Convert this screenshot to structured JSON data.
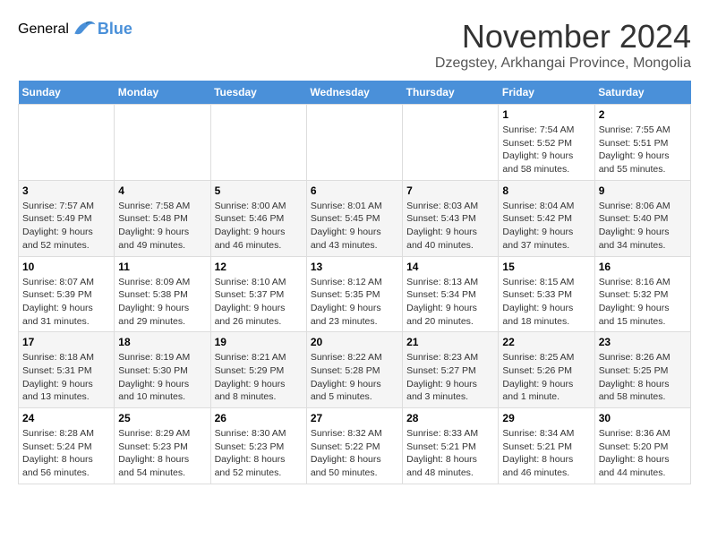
{
  "logo": {
    "general": "General",
    "blue": "Blue"
  },
  "title": {
    "month_year": "November 2024",
    "location": "Dzegstey, Arkhangai Province, Mongolia"
  },
  "weekdays": [
    "Sunday",
    "Monday",
    "Tuesday",
    "Wednesday",
    "Thursday",
    "Friday",
    "Saturday"
  ],
  "weeks": [
    [
      {
        "day": "",
        "info": ""
      },
      {
        "day": "",
        "info": ""
      },
      {
        "day": "",
        "info": ""
      },
      {
        "day": "",
        "info": ""
      },
      {
        "day": "",
        "info": ""
      },
      {
        "day": "1",
        "info": "Sunrise: 7:54 AM\nSunset: 5:52 PM\nDaylight: 9 hours\nand 58 minutes."
      },
      {
        "day": "2",
        "info": "Sunrise: 7:55 AM\nSunset: 5:51 PM\nDaylight: 9 hours\nand 55 minutes."
      }
    ],
    [
      {
        "day": "3",
        "info": "Sunrise: 7:57 AM\nSunset: 5:49 PM\nDaylight: 9 hours\nand 52 minutes."
      },
      {
        "day": "4",
        "info": "Sunrise: 7:58 AM\nSunset: 5:48 PM\nDaylight: 9 hours\nand 49 minutes."
      },
      {
        "day": "5",
        "info": "Sunrise: 8:00 AM\nSunset: 5:46 PM\nDaylight: 9 hours\nand 46 minutes."
      },
      {
        "day": "6",
        "info": "Sunrise: 8:01 AM\nSunset: 5:45 PM\nDaylight: 9 hours\nand 43 minutes."
      },
      {
        "day": "7",
        "info": "Sunrise: 8:03 AM\nSunset: 5:43 PM\nDaylight: 9 hours\nand 40 minutes."
      },
      {
        "day": "8",
        "info": "Sunrise: 8:04 AM\nSunset: 5:42 PM\nDaylight: 9 hours\nand 37 minutes."
      },
      {
        "day": "9",
        "info": "Sunrise: 8:06 AM\nSunset: 5:40 PM\nDaylight: 9 hours\nand 34 minutes."
      }
    ],
    [
      {
        "day": "10",
        "info": "Sunrise: 8:07 AM\nSunset: 5:39 PM\nDaylight: 9 hours\nand 31 minutes."
      },
      {
        "day": "11",
        "info": "Sunrise: 8:09 AM\nSunset: 5:38 PM\nDaylight: 9 hours\nand 29 minutes."
      },
      {
        "day": "12",
        "info": "Sunrise: 8:10 AM\nSunset: 5:37 PM\nDaylight: 9 hours\nand 26 minutes."
      },
      {
        "day": "13",
        "info": "Sunrise: 8:12 AM\nSunset: 5:35 PM\nDaylight: 9 hours\nand 23 minutes."
      },
      {
        "day": "14",
        "info": "Sunrise: 8:13 AM\nSunset: 5:34 PM\nDaylight: 9 hours\nand 20 minutes."
      },
      {
        "day": "15",
        "info": "Sunrise: 8:15 AM\nSunset: 5:33 PM\nDaylight: 9 hours\nand 18 minutes."
      },
      {
        "day": "16",
        "info": "Sunrise: 8:16 AM\nSunset: 5:32 PM\nDaylight: 9 hours\nand 15 minutes."
      }
    ],
    [
      {
        "day": "17",
        "info": "Sunrise: 8:18 AM\nSunset: 5:31 PM\nDaylight: 9 hours\nand 13 minutes."
      },
      {
        "day": "18",
        "info": "Sunrise: 8:19 AM\nSunset: 5:30 PM\nDaylight: 9 hours\nand 10 minutes."
      },
      {
        "day": "19",
        "info": "Sunrise: 8:21 AM\nSunset: 5:29 PM\nDaylight: 9 hours\nand 8 minutes."
      },
      {
        "day": "20",
        "info": "Sunrise: 8:22 AM\nSunset: 5:28 PM\nDaylight: 9 hours\nand 5 minutes."
      },
      {
        "day": "21",
        "info": "Sunrise: 8:23 AM\nSunset: 5:27 PM\nDaylight: 9 hours\nand 3 minutes."
      },
      {
        "day": "22",
        "info": "Sunrise: 8:25 AM\nSunset: 5:26 PM\nDaylight: 9 hours\nand 1 minute."
      },
      {
        "day": "23",
        "info": "Sunrise: 8:26 AM\nSunset: 5:25 PM\nDaylight: 8 hours\nand 58 minutes."
      }
    ],
    [
      {
        "day": "24",
        "info": "Sunrise: 8:28 AM\nSunset: 5:24 PM\nDaylight: 8 hours\nand 56 minutes."
      },
      {
        "day": "25",
        "info": "Sunrise: 8:29 AM\nSunset: 5:23 PM\nDaylight: 8 hours\nand 54 minutes."
      },
      {
        "day": "26",
        "info": "Sunrise: 8:30 AM\nSunset: 5:23 PM\nDaylight: 8 hours\nand 52 minutes."
      },
      {
        "day": "27",
        "info": "Sunrise: 8:32 AM\nSunset: 5:22 PM\nDaylight: 8 hours\nand 50 minutes."
      },
      {
        "day": "28",
        "info": "Sunrise: 8:33 AM\nSunset: 5:21 PM\nDaylight: 8 hours\nand 48 minutes."
      },
      {
        "day": "29",
        "info": "Sunrise: 8:34 AM\nSunset: 5:21 PM\nDaylight: 8 hours\nand 46 minutes."
      },
      {
        "day": "30",
        "info": "Sunrise: 8:36 AM\nSunset: 5:20 PM\nDaylight: 8 hours\nand 44 minutes."
      }
    ]
  ]
}
